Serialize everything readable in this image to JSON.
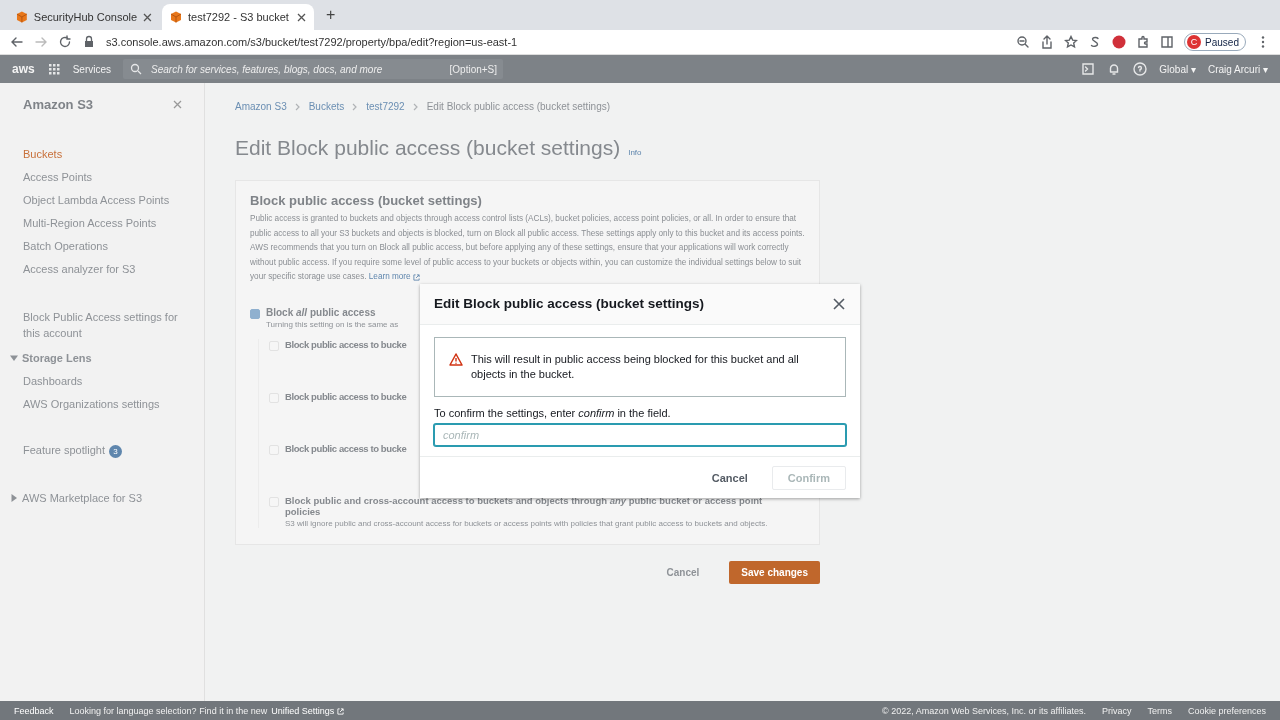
{
  "browser": {
    "tabs": [
      {
        "title": "SecurityHub Console",
        "selected": false
      },
      {
        "title": "test7292 - S3 bucket",
        "selected": true
      }
    ],
    "new_tab": "+",
    "url": "s3.console.aws.amazon.com/s3/bucket/test7292/property/bpa/edit?region=us-east-1",
    "profile": {
      "initial": "C",
      "status": "Paused"
    }
  },
  "console_nav": {
    "logo": "aws",
    "services": "Services",
    "search_placeholder": "Search for services, features, blogs, docs, and more",
    "shortcut": "[Option+S]",
    "region": "Global ▾",
    "user": "Craig Arcuri ▾"
  },
  "sidebar": {
    "title": "Amazon S3",
    "items": [
      {
        "label": "Buckets",
        "selected": true
      },
      {
        "label": "Access Points",
        "selected": false
      },
      {
        "label": "Object Lambda Access Points",
        "selected": false
      },
      {
        "label": "Multi-Region Access Points",
        "selected": false
      },
      {
        "label": "Batch Operations",
        "selected": false
      },
      {
        "label": "Access analyzer for S3",
        "selected": false
      }
    ],
    "account_link": "Block Public Access settings for this account",
    "storage_lens": {
      "label": "Storage Lens",
      "expanded": true,
      "children": [
        {
          "label": "Dashboards"
        },
        {
          "label": "AWS Organizations settings"
        }
      ]
    },
    "feature_spotlight": {
      "label": "Feature spotlight",
      "count": "3"
    },
    "marketplace": {
      "label": "AWS Marketplace for S3",
      "expanded": false
    }
  },
  "breadcrumbs": [
    "Amazon S3",
    "Buckets",
    "test7292",
    "Edit Block public access (bucket settings)"
  ],
  "page": {
    "title": "Edit Block public access (bucket settings)",
    "info": "Info"
  },
  "panel": {
    "title": "Block public access (bucket settings)",
    "description": "Public access is granted to buckets and objects through access control lists (ACLs), bucket policies, access point policies, or all. In order to ensure that public access to all your S3 buckets and objects is blocked, turn on Block all public access. These settings apply only to this bucket and its access points. AWS recommends that you turn on Block all public access, but before applying any of these settings, ensure that your applications will work correctly without public access. If you require some level of public access to your buckets or objects within, you can customize the individual settings below to suit your specific storage use cases.",
    "learn_more": "Learn more",
    "main_option": {
      "label": "Block *all* public access",
      "description": "Turning this setting on is the same as",
      "checked": true
    },
    "options": [
      {
        "label": "Block public access to bucke",
        "checked": false
      },
      {
        "label": "Block public access to bucke",
        "checked": false
      },
      {
        "label": "Block public access to bucke",
        "checked": false
      },
      {
        "label": "Block public and cross-account access to buckets and objects through *any* public bucket or access point policies",
        "description": "S3 will ignore public and cross-account access for buckets or access points with policies that grant public access to buckets and objects.",
        "checked": false
      }
    ]
  },
  "actions": {
    "cancel": "Cancel",
    "save": "Save changes"
  },
  "footer": {
    "feedback": "Feedback",
    "language_note": "Looking for language selection? Find it in the new",
    "unified_settings": "Unified Settings",
    "copyright": "© 2022, Amazon Web Services, Inc. or its affiliates.",
    "links": [
      "Privacy",
      "Terms",
      "Cookie preferences"
    ]
  },
  "modal": {
    "title": "Edit Block public access (bucket settings)",
    "warning": "This will result in public access being blocked for this bucket and all objects in the bucket.",
    "instruction": "To confirm the settings, enter *confirm* in the field.",
    "placeholder": "confirm",
    "cancel": "Cancel",
    "confirm": "Confirm",
    "confirm_disabled": true
  }
}
